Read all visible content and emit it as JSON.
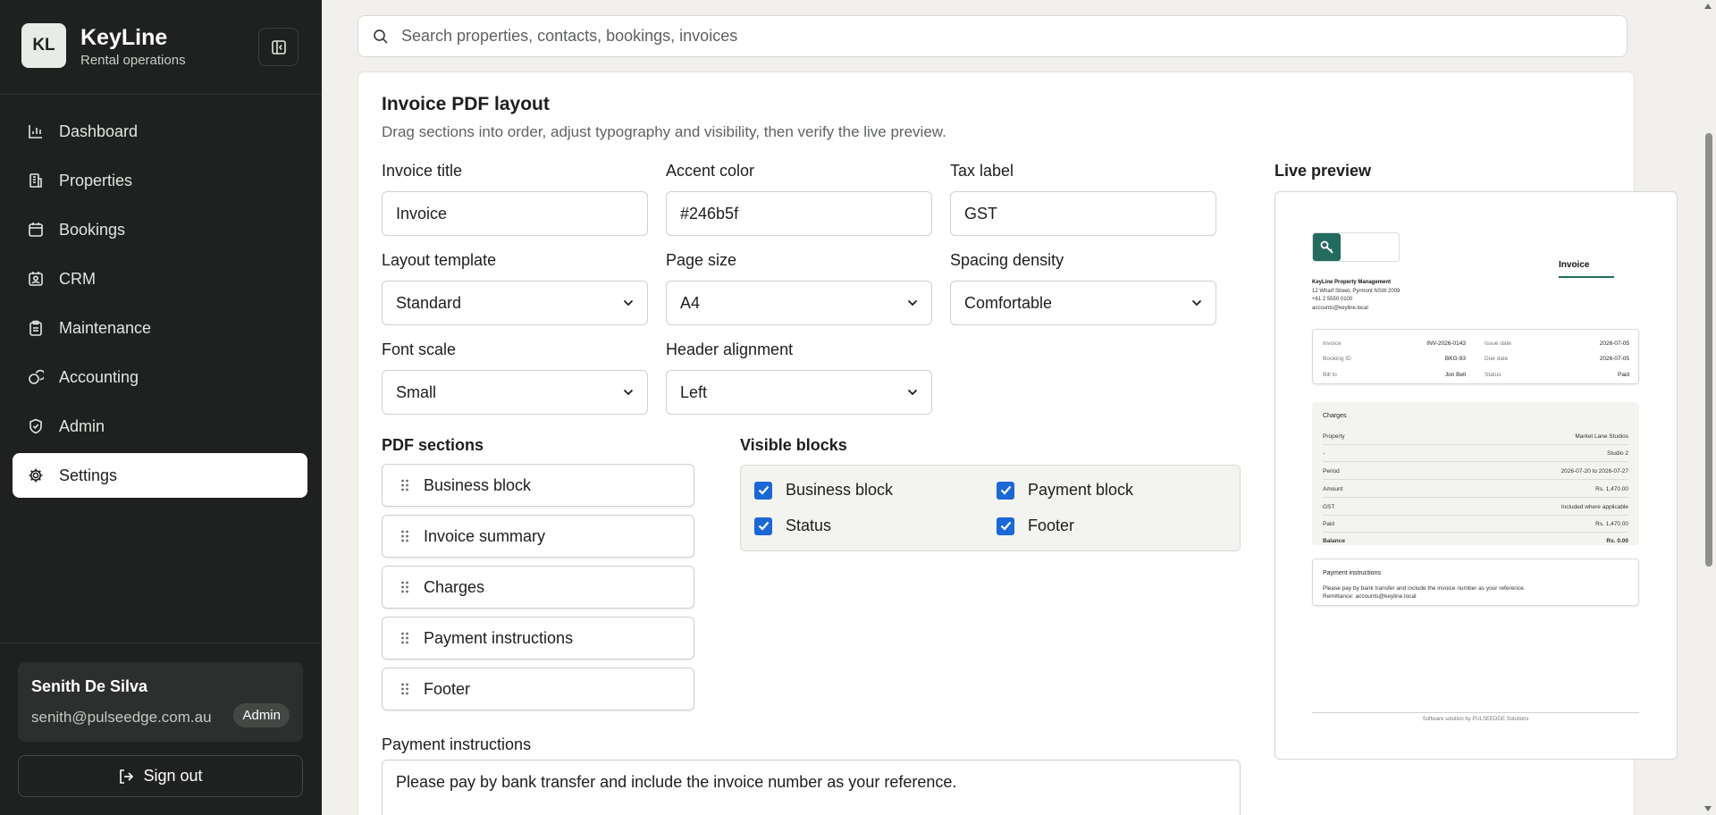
{
  "app": {
    "logo_initials": "KL",
    "name": "KeyLine",
    "subtitle": "Rental operations"
  },
  "sidebar": {
    "items": [
      {
        "label": "Dashboard",
        "icon": "chart-bar-icon"
      },
      {
        "label": "Properties",
        "icon": "building-icon"
      },
      {
        "label": "Bookings",
        "icon": "calendar-icon"
      },
      {
        "label": "CRM",
        "icon": "contact-icon"
      },
      {
        "label": "Maintenance",
        "icon": "clipboard-icon"
      },
      {
        "label": "Accounting",
        "icon": "coins-icon"
      },
      {
        "label": "Admin",
        "icon": "shield-icon"
      },
      {
        "label": "Settings",
        "icon": "gear-icon",
        "active": true
      }
    ],
    "user": {
      "name": "Senith De Silva",
      "email": "senith@pulseedge.com.au",
      "role": "Admin"
    },
    "signout_label": "Sign out"
  },
  "search": {
    "placeholder": "Search properties, contacts, bookings, invoices"
  },
  "page": {
    "title": "Invoice PDF layout",
    "description": "Drag sections into order, adjust typography and visibility, then verify the live preview."
  },
  "fields": {
    "invoice_title": {
      "label": "Invoice title",
      "value": "Invoice"
    },
    "accent_color": {
      "label": "Accent color",
      "value": "#246b5f"
    },
    "tax_label": {
      "label": "Tax label",
      "value": "GST"
    },
    "layout_template": {
      "label": "Layout template",
      "value": "Standard"
    },
    "page_size": {
      "label": "Page size",
      "value": "A4"
    },
    "spacing_density": {
      "label": "Spacing density",
      "value": "Comfortable"
    },
    "font_scale": {
      "label": "Font scale",
      "value": "Small"
    },
    "header_alignment": {
      "label": "Header alignment",
      "value": "Left"
    }
  },
  "pdf_sections": {
    "label": "PDF sections",
    "items": [
      "Business block",
      "Invoice summary",
      "Charges",
      "Payment instructions",
      "Footer"
    ]
  },
  "visible_blocks": {
    "label": "Visible blocks",
    "items": [
      {
        "label": "Business block",
        "checked": true
      },
      {
        "label": "Payment block",
        "checked": true
      },
      {
        "label": "Status",
        "checked": true
      },
      {
        "label": "Footer",
        "checked": true
      }
    ]
  },
  "payment_instructions": {
    "label": "Payment instructions",
    "value": "Please pay by bank transfer and include the invoice number as your reference."
  },
  "preview": {
    "label": "Live preview",
    "doc_title": "Invoice",
    "business": {
      "name": "KeyLine Property Management",
      "address": "12 Wharf Street, Pyrmont NSW 2009",
      "phone": "+61 2 5550 0100",
      "email": "accounts@keyline.local"
    },
    "summary": {
      "invoice_label": "Invoice",
      "invoice_value": "INV-2026-0143",
      "issue_label": "Issue date",
      "issue_value": "2026-07-05",
      "booking_label": "Booking ID",
      "booking_value": "BKG-93",
      "due_label": "Due date",
      "due_value": "2026-07-05",
      "bill_label": "Bill to",
      "bill_value": "Jon Bell",
      "status_label": "Status",
      "status_value": "Paid"
    },
    "charges": {
      "title": "Charges",
      "rows": [
        {
          "k": "Property",
          "v": "Market Lane Studios"
        },
        {
          "k": "-",
          "v": "Studio 2"
        },
        {
          "k": "Period",
          "v": "2026-07-20 to 2026-07-27"
        },
        {
          "k": "Amount",
          "v": "Rs. 1,470.00"
        },
        {
          "k": "GST",
          "v": "Included where applicable"
        },
        {
          "k": "Paid",
          "v": "Rs. 1,470.00"
        },
        {
          "k": "Balance",
          "v": "Rs. 0.00"
        }
      ]
    },
    "payment": {
      "title": "Payment instructions",
      "line1": "Please pay by bank transfer and include the invoice number as your reference.",
      "line2": "Remittance: accounts@keyline.local"
    },
    "footer": "Software solution by PULSEEDGE Solutions"
  },
  "colors": {
    "sidebar_bg": "#1f2120",
    "accent": "#246b5f",
    "checkbox": "#1a68d6"
  }
}
